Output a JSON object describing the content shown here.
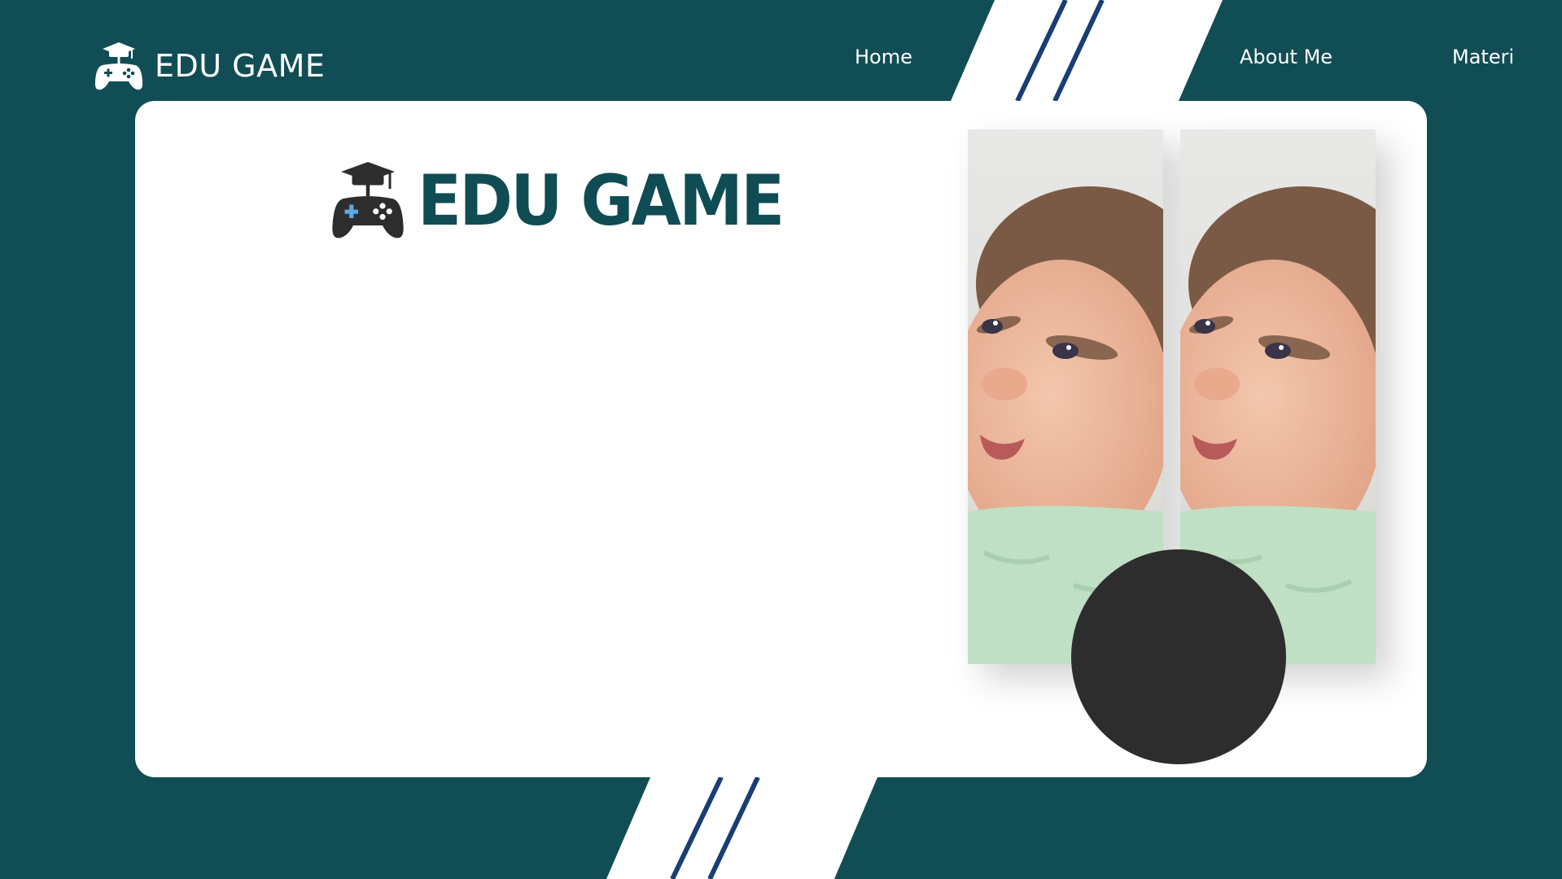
{
  "colors": {
    "background": "#114d55",
    "card": "#ffffff",
    "accent_stripe": "#1a3d74",
    "logo_text": "#0f4c54",
    "circle": "#2d2d2d"
  },
  "header": {
    "brand": "EDU GAME",
    "brand_icon": "gamepad-graduation-cap-icon",
    "nav": {
      "home": "Home",
      "about": "About Me",
      "materi": "Materi"
    }
  },
  "hero": {
    "logo_text": "EDU GAME",
    "logo_icon": "gamepad-graduation-cap-icon"
  },
  "photos": {
    "description_icon": "baby-photo"
  }
}
